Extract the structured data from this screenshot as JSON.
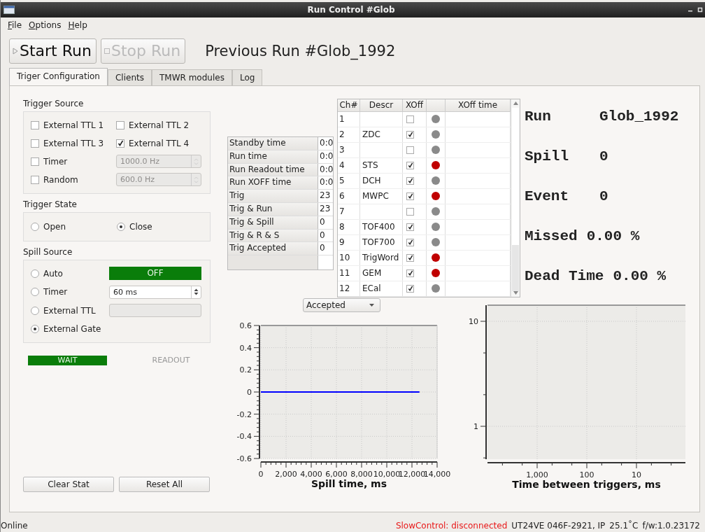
{
  "window": {
    "title": "Run Control #Glob"
  },
  "menu": [
    {
      "label": "File"
    },
    {
      "label": "Options"
    },
    {
      "label": "Help"
    }
  ],
  "toolbar": {
    "start": {
      "label": "Start Run",
      "disabled": false
    },
    "stop": {
      "label": "Stop Run",
      "disabled": true
    },
    "previous_run": "Previous Run #Glob_1992"
  },
  "tabs": [
    {
      "label": "Triger Configuration",
      "selected": true
    },
    {
      "label": "Clients",
      "selected": false
    },
    {
      "label": "TMWR modules",
      "selected": false
    },
    {
      "label": "Log",
      "selected": false
    }
  ],
  "trigger_source": {
    "title": "Trigger Source",
    "checks": [
      {
        "label": "External TTL 1",
        "checked": false
      },
      {
        "label": "External TTL 2",
        "checked": false
      },
      {
        "label": "External TTL 3",
        "checked": false
      },
      {
        "label": "External TTL 4",
        "checked": true
      }
    ],
    "rates": [
      {
        "label": "Timer",
        "checked": false,
        "value": "1000.0 Hz",
        "disabled": true
      },
      {
        "label": "Random",
        "checked": false,
        "value": "600.0 Hz",
        "disabled": true
      }
    ]
  },
  "trigger_state": {
    "title": "Trigger State",
    "options": [
      {
        "label": "Open",
        "selected": false
      },
      {
        "label": "Close",
        "selected": true
      }
    ]
  },
  "spill_source": {
    "title": "Spill Source",
    "options": [
      {
        "label": "Auto",
        "selected": false,
        "kind": "indicator",
        "value": "OFF",
        "on": true
      },
      {
        "label": "Timer",
        "selected": false,
        "kind": "spin",
        "value": "60 ms"
      },
      {
        "label": "External TTL",
        "selected": false,
        "kind": "blank"
      },
      {
        "label": "External Gate",
        "selected": true,
        "kind": "none"
      }
    ]
  },
  "status_lights": [
    {
      "label": "WAIT",
      "on": true
    },
    {
      "label": "READOUT",
      "on": false
    }
  ],
  "counters": [
    {
      "label": "Standby time",
      "value": "0:0"
    },
    {
      "label": "Run time",
      "value": "0:0"
    },
    {
      "label": "Run Readout time",
      "value": "0:0"
    },
    {
      "label": "Run XOFF time",
      "value": "0:0"
    },
    {
      "label": "Trig",
      "value": "23"
    },
    {
      "label": "Trig & Run",
      "value": "23"
    },
    {
      "label": "Trig & Spill",
      "value": "0"
    },
    {
      "label": "Trig & R & S",
      "value": "0"
    },
    {
      "label": "Trig Accepted",
      "value": "0"
    }
  ],
  "channels": {
    "columns": [
      "Ch#",
      "Descr",
      "XOff",
      "XOff time"
    ],
    "rows": [
      {
        "ch": "1",
        "descr": "",
        "xoff": false,
        "color": "#8a8a8a"
      },
      {
        "ch": "2",
        "descr": "ZDC",
        "xoff": true,
        "color": "#8a8a8a"
      },
      {
        "ch": "3",
        "descr": "",
        "xoff": false,
        "color": "#8a8a8a"
      },
      {
        "ch": "4",
        "descr": "STS",
        "xoff": true,
        "color": "#c00000"
      },
      {
        "ch": "5",
        "descr": "DCH",
        "xoff": true,
        "color": "#8a8a8a"
      },
      {
        "ch": "6",
        "descr": "MWPC",
        "xoff": true,
        "color": "#c00000"
      },
      {
        "ch": "7",
        "descr": "",
        "xoff": false,
        "color": "#8a8a8a"
      },
      {
        "ch": "8",
        "descr": "TOF400",
        "xoff": true,
        "color": "#8a8a8a"
      },
      {
        "ch": "9",
        "descr": "TOF700",
        "xoff": true,
        "color": "#8a8a8a"
      },
      {
        "ch": "10",
        "descr": "TrigWord",
        "xoff": true,
        "color": "#c00000"
      },
      {
        "ch": "11",
        "descr": "GEM",
        "xoff": true,
        "color": "#c00000"
      },
      {
        "ch": "12",
        "descr": "ECal",
        "xoff": true,
        "color": "#8a8a8a"
      }
    ]
  },
  "stats": [
    {
      "label": "Run",
      "value": "Glob_1992"
    },
    {
      "label": "Spill",
      "value": "0"
    },
    {
      "label": "Event",
      "value": "0"
    },
    {
      "label": "Missed",
      "value": "0.00 %"
    },
    {
      "label": "Dead Time",
      "value": "0.00 %"
    }
  ],
  "plot_selector": {
    "value": "Accepted"
  },
  "spill_chart": {
    "chart_data": {
      "type": "line",
      "xlabel": "Spill time, ms",
      "x": [
        0,
        12600
      ],
      "series": [
        {
          "color": "#0000ff",
          "values": [
            0,
            0
          ]
        }
      ],
      "xlim": [
        0,
        14000
      ],
      "ylim": [
        -0.6,
        0.6
      ],
      "grid": true,
      "xticks": [
        {
          "value": 0,
          "label": "0"
        },
        {
          "value": 2000,
          "label": "2,000"
        },
        {
          "value": 4000,
          "label": "4,000"
        },
        {
          "value": 6000,
          "label": "6,000"
        },
        {
          "value": 8000,
          "label": "8,000"
        },
        {
          "value": 10000,
          "label": "10,000"
        },
        {
          "value": 12000,
          "label": "12,000"
        },
        {
          "value": 14000,
          "label": "14,000"
        }
      ],
      "yticks": [
        0.6,
        0.4,
        0.2,
        0,
        -0.2,
        -0.4,
        -0.6
      ]
    }
  },
  "interval_chart": {
    "xlabel": "Time between triggers, ms",
    "xticks": [
      "1,000",
      "100",
      "10"
    ],
    "yticks": [
      "10",
      "1"
    ]
  },
  "buttons": [
    "Clear Stat",
    "Reset All"
  ],
  "status_bar": {
    "state": "Online",
    "slow_control": "SlowControl: disconnected",
    "device": "UT24VE 046F-2921, IP",
    "temperature": "25.1˚C",
    "firmware": "f/w:1.0.23172"
  }
}
